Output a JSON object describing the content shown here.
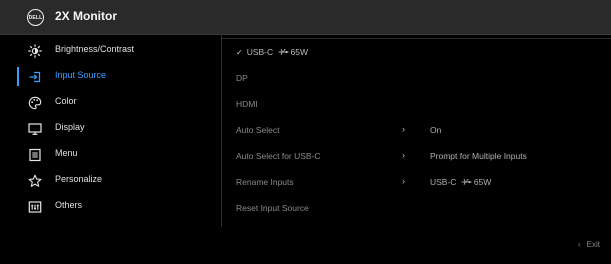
{
  "header": {
    "logo_text": "DELL",
    "model": "2X Monitor"
  },
  "menu": {
    "items": [
      {
        "label": "Brightness/Contrast",
        "icon": "brightness-icon"
      },
      {
        "label": "Input Source",
        "icon": "input-source-icon",
        "active": true
      },
      {
        "label": "Color",
        "icon": "color-palette-icon"
      },
      {
        "label": "Display",
        "icon": "display-icon"
      },
      {
        "label": "Menu",
        "icon": "menu-icon"
      },
      {
        "label": "Personalize",
        "icon": "star-icon"
      },
      {
        "label": "Others",
        "icon": "others-icon"
      }
    ]
  },
  "options": {
    "items": [
      {
        "label": "USB-C",
        "suffix": "65W",
        "selected": true
      },
      {
        "label": "DP"
      },
      {
        "label": "HDMI"
      },
      {
        "label": "Auto Select",
        "value": "On"
      },
      {
        "label": "Auto Select for USB-C",
        "value": "Prompt for Multiple Inputs"
      },
      {
        "label": "Rename Inputs",
        "value": "USB-C",
        "value_suffix": "65W"
      },
      {
        "label": "Reset Input Source"
      }
    ]
  },
  "footer": {
    "exit_label": "Exit"
  },
  "colors": {
    "accent": "#3aa0ff",
    "background": "#000000",
    "header": "#2a2a2a"
  }
}
